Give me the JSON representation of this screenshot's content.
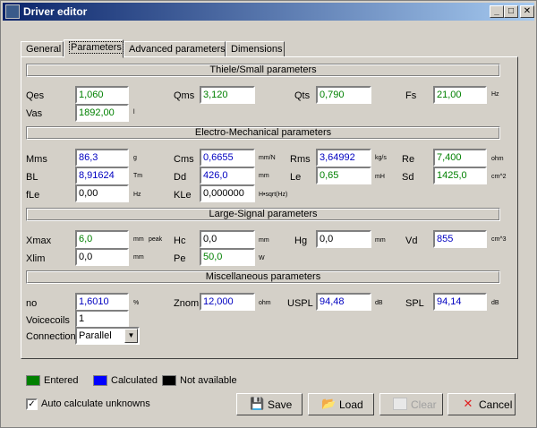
{
  "window": {
    "title": "Driver editor"
  },
  "titlebar_buttons": {
    "minimize": "_",
    "maximize": "□",
    "close": "✕"
  },
  "tabs": [
    {
      "label": "General"
    },
    {
      "label": "Parameters",
      "active": true
    },
    {
      "label": "Advanced parameters"
    },
    {
      "label": "Dimensions"
    }
  ],
  "sections": {
    "thiele": "Thiele/Small parameters",
    "electro": "Electro-Mechanical parameters",
    "large": "Large-Signal parameters",
    "misc": "Miscellaneous parameters"
  },
  "params": {
    "qes": {
      "label": "Qes",
      "value": "1,060",
      "status": "green"
    },
    "qms": {
      "label": "Qms",
      "value": "3,120",
      "status": "green"
    },
    "qts": {
      "label": "Qts",
      "value": "0,790",
      "status": "green"
    },
    "fs": {
      "label": "Fs",
      "value": "21,00",
      "unit": "Hz",
      "status": "green"
    },
    "vas": {
      "label": "Vas",
      "value": "1892,00",
      "unit": "l",
      "status": "green"
    },
    "mms": {
      "label": "Mms",
      "value": "86,3",
      "unit": "g",
      "status": "blue"
    },
    "cms": {
      "label": "Cms",
      "value": "0,6655",
      "unit": "mm/N",
      "status": "blue"
    },
    "rms": {
      "label": "Rms",
      "value": "3,64992",
      "unit": "kg/s",
      "status": "blue"
    },
    "re": {
      "label": "Re",
      "value": "7,400",
      "unit": "ohm",
      "status": "green"
    },
    "bl": {
      "label": "BL",
      "value": "8,91624",
      "unit": "Tm",
      "status": "blue"
    },
    "dd": {
      "label": "Dd",
      "value": "426,0",
      "unit": "mm",
      "status": "blue"
    },
    "le": {
      "label": "Le",
      "value": "0,65",
      "unit": "mH",
      "status": "green"
    },
    "sd": {
      "label": "Sd",
      "value": "1425,0",
      "unit": "cm^2",
      "status": "green"
    },
    "fle": {
      "label": "fLe",
      "value": "0,00",
      "unit": "Hz",
      "status": "black"
    },
    "kle": {
      "label": "KLe",
      "value": "0,000000",
      "unit": "H•sqrt(Hz)",
      "status": "black"
    },
    "xmax": {
      "label": "Xmax",
      "value": "6,0",
      "unit": "mm",
      "unit2": "peak",
      "status": "green"
    },
    "hc": {
      "label": "Hc",
      "value": "0,0",
      "unit": "mm",
      "status": "black"
    },
    "hg": {
      "label": "Hg",
      "value": "0,0",
      "unit": "mm",
      "status": "black"
    },
    "vd": {
      "label": "Vd",
      "value": "855",
      "unit": "cm^3",
      "status": "blue"
    },
    "xlim": {
      "label": "Xlim",
      "value": "0,0",
      "unit": "mm",
      "status": "black"
    },
    "pe": {
      "label": "Pe",
      "value": "50,0",
      "unit": "W",
      "status": "green"
    },
    "no": {
      "label": "no",
      "value": "1,6010",
      "unit": "%",
      "status": "blue"
    },
    "znom": {
      "label": "Znom",
      "value": "12,000",
      "unit": "ohm",
      "status": "blue"
    },
    "uspl": {
      "label": "USPL",
      "value": "94,48",
      "unit": "dB",
      "status": "blue"
    },
    "spl": {
      "label": "SPL",
      "value": "94,14",
      "unit": "dB",
      "status": "blue"
    },
    "voicecoils": {
      "label": "Voicecoils",
      "value": "1"
    },
    "connection": {
      "label": "Connection",
      "value": "Parallel"
    }
  },
  "legend": {
    "entered": {
      "label": "Entered",
      "color": "#008000"
    },
    "calculated": {
      "label": "Calculated",
      "color": "#0000ff"
    },
    "not_available": {
      "label": "Not available",
      "color": "#000000"
    }
  },
  "auto_calc": {
    "label": "Auto calculate unknowns",
    "checked": true
  },
  "buttons": {
    "save": {
      "label": "Save",
      "icon": "floppy-icon"
    },
    "load": {
      "label": "Load",
      "icon": "folder-icon"
    },
    "clear": {
      "label": "Clear",
      "icon": "clear-icon",
      "disabled": true
    },
    "cancel": {
      "label": "Cancel",
      "icon": "cancel-x-icon"
    }
  }
}
